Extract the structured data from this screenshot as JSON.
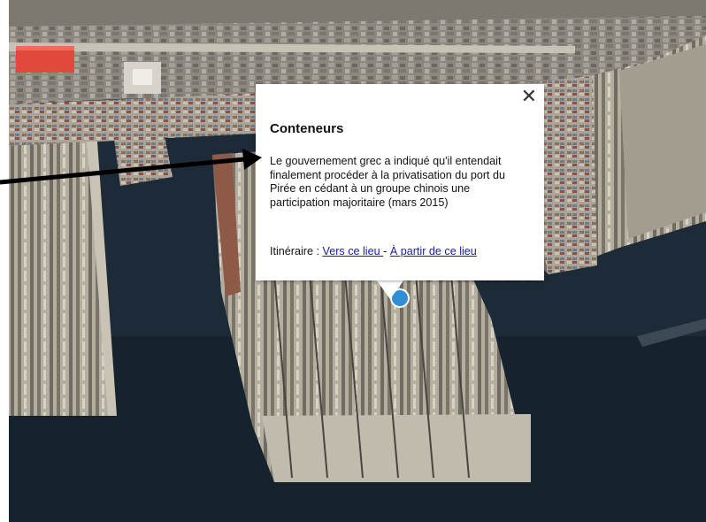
{
  "popup": {
    "title": "Conteneurs",
    "description": "Le gouvernement grec a indiqué qu'il entendait finalement procéder à la privatisation du port du Pirée en cédant à un groupe chinois une participation majoritaire (mars 2015)",
    "route_label": "Itinéraire : ",
    "link_to": "Vers ce lieu ",
    "separator": "- ",
    "link_from": "À partir de ce lieu",
    "close_glyph": "✕"
  },
  "placemark": {
    "label": "Conteneurs",
    "icon": "blue-circle-pin-icon"
  },
  "colors": {
    "sea": "#1d2b38",
    "land": "#9a968c",
    "quay": "#b7b2a6",
    "link": "#1a1ab0",
    "pin": "#2f8fd6"
  }
}
